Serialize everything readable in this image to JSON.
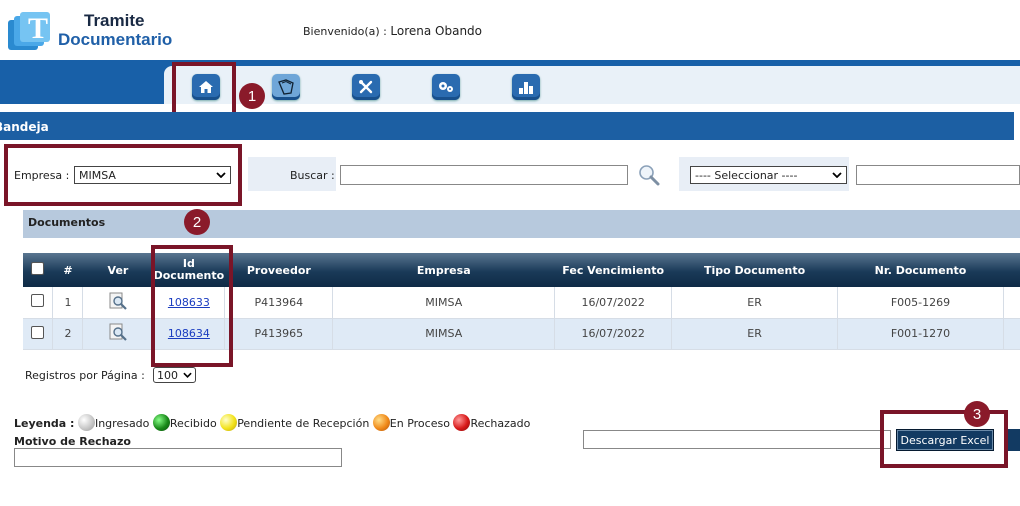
{
  "app": {
    "title_line1": "Tramite",
    "title_line2": "Documentario"
  },
  "welcome": {
    "prefix": "Bienvenido(a) :",
    "user": "Lorena Obando"
  },
  "nav": {
    "icons": [
      "home-icon",
      "book-icon",
      "tools-icon",
      "settings-icon",
      "chart-icon"
    ]
  },
  "annotations": [
    "1",
    "2",
    "3"
  ],
  "section_title": "Bandeja",
  "filters": {
    "empresa_label": "Empresa :",
    "empresa_value": "MIMSA",
    "buscar_label": "Buscar :",
    "buscar_value": "",
    "select_value": "---- Seleccionar ----"
  },
  "documents": {
    "title": "Documentos",
    "columns": [
      "#",
      "Ver",
      "Id Documento",
      "Proveedor",
      "Empresa",
      "Fec Vencimiento",
      "Tipo Documento",
      "Nr. Documento"
    ],
    "rows": [
      {
        "num": "1",
        "id": "108633",
        "proveedor": "P413964",
        "empresa": "MIMSA",
        "fecha": "16/07/2022",
        "tipo": "ER",
        "nro": "F005-1269"
      },
      {
        "num": "2",
        "id": "108634",
        "proveedor": "P413965",
        "empresa": "MIMSA",
        "fecha": "16/07/2022",
        "tipo": "ER",
        "nro": "F001-1270"
      }
    ]
  },
  "pagination": {
    "label": "Registros por Página :",
    "value": "100"
  },
  "legend": {
    "title": "Leyenda :",
    "items": [
      {
        "label": "Ingresado",
        "color": "#c8c8c8"
      },
      {
        "label": "Recibido",
        "color": "#1a8a1a"
      },
      {
        "label": "Pendiente de Recepción",
        "color": "#f2e21a"
      },
      {
        "label": "En Proceso",
        "color": "#f08a1a"
      },
      {
        "label": "Rechazado",
        "color": "#d81a1a"
      }
    ]
  },
  "motivo": {
    "label": "Motivo de Rechazo",
    "value": ""
  },
  "excel_button": "Descargar Excel"
}
